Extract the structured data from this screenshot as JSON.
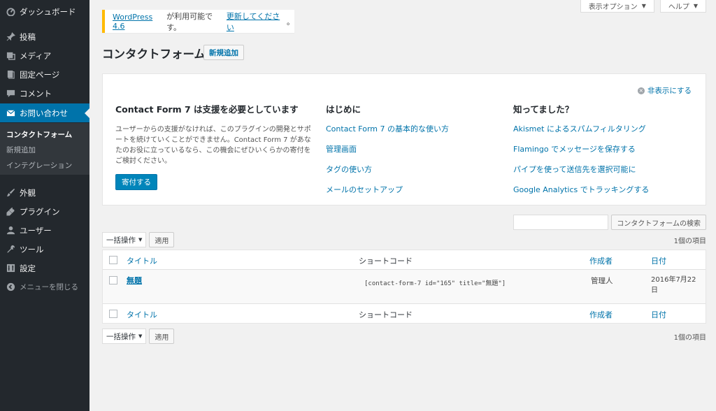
{
  "sidebar": {
    "items": [
      {
        "label": "ダッシュボード",
        "icon": "dashboard-icon"
      },
      {
        "label": "投稿",
        "icon": "pin-icon"
      },
      {
        "label": "メディア",
        "icon": "media-icon"
      },
      {
        "label": "固定ページ",
        "icon": "page-icon"
      },
      {
        "label": "コメント",
        "icon": "comment-icon"
      },
      {
        "label": "お問い合わせ",
        "icon": "mail-icon"
      },
      {
        "label": "外観",
        "icon": "brush-icon"
      },
      {
        "label": "プラグイン",
        "icon": "plugin-icon"
      },
      {
        "label": "ユーザー",
        "icon": "user-icon"
      },
      {
        "label": "ツール",
        "icon": "wrench-icon"
      },
      {
        "label": "設定",
        "icon": "settings-icon"
      }
    ],
    "submenu": [
      "コンタクトフォーム",
      "新規追加",
      "インテグレーション"
    ],
    "collapse": "メニューを閉じる"
  },
  "screen_meta": {
    "options": "表示オプション",
    "help": "ヘルプ"
  },
  "notice": {
    "link": "WordPress 4.6",
    "text": " が利用可能です。",
    "update": "更新してください",
    "end": "。"
  },
  "page": {
    "title": "コンタクトフォーム",
    "add_new": "新規追加"
  },
  "welcome": {
    "dismiss": "非表示にする",
    "col1": {
      "heading": "Contact Form 7 は支援を必要としています",
      "body": "ユーザーからの支援がなければ、このプラグインの開発とサポートを続けていくことができません。Contact Form 7 があなたのお役に立っているなら、この機会にぜひいくらかの寄付をご検討ください。",
      "button": "寄付する"
    },
    "col2": {
      "heading": "はじめに",
      "links": [
        "Contact Form 7 の基本的な使い方",
        "管理画面",
        "タグの使い方",
        "メールのセットアップ"
      ]
    },
    "col3": {
      "heading": "知ってました？",
      "links": [
        "Akismet によるスパムフィルタリング",
        "Flamingo でメッセージを保存する",
        "パイプを使って送信先を選択可能に",
        "Google Analytics でトラッキングする"
      ]
    }
  },
  "search": {
    "button": "コンタクトフォームの検索"
  },
  "tablenav": {
    "bulk": "一括操作",
    "apply": "適用",
    "count": "1個の項目"
  },
  "table": {
    "columns": {
      "title": "タイトル",
      "shortcode": "ショートコード",
      "author": "作成者",
      "date": "日付"
    },
    "rows": [
      {
        "title": "無題",
        "shortcode": "[contact-form-7 id=\"165\" title=\"無題\"]",
        "author": "管理人",
        "date_line1": "2016年7月22",
        "date_line2": "日"
      }
    ]
  },
  "colors": {
    "sidebar_bg": "#23282d",
    "accent": "#0073aa",
    "notice_border": "#ffba00"
  }
}
